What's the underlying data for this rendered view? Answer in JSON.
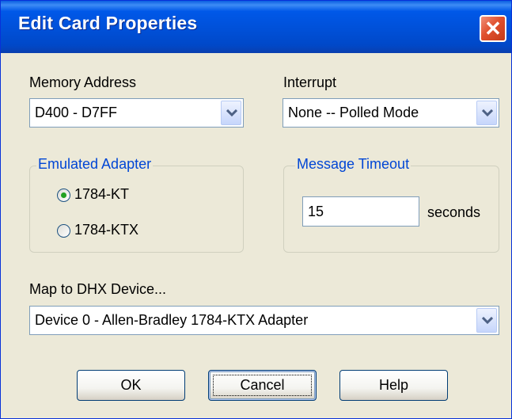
{
  "dialog": {
    "title": "Edit Card Properties"
  },
  "memory_address": {
    "label": "Memory Address",
    "value": "D400 - D7FF"
  },
  "interrupt": {
    "label": "Interrupt",
    "value": "None -- Polled Mode"
  },
  "emulated_adapter": {
    "label": "Emulated Adapter",
    "options": [
      {
        "label": "1784-KT",
        "selected": true
      },
      {
        "label": "1784-KTX",
        "selected": false
      }
    ]
  },
  "message_timeout": {
    "label": "Message Timeout",
    "value": "15",
    "unit": "seconds"
  },
  "map_device": {
    "label": "Map to DHX Device...",
    "value": "Device 0 - Allen-Bradley 1784-KTX Adapter"
  },
  "buttons": {
    "ok": "OK",
    "cancel": "Cancel",
    "help": "Help"
  },
  "icons": {
    "close": "close-icon",
    "dropdown": "chevron-down-icon",
    "radio": "radio-icon"
  },
  "colors": {
    "title_bar": "#0054e3",
    "group_label": "#0046d5",
    "close_button": "#e0502e",
    "radio_dot": "#21a121",
    "dialog_bg": "#ece9d8"
  }
}
